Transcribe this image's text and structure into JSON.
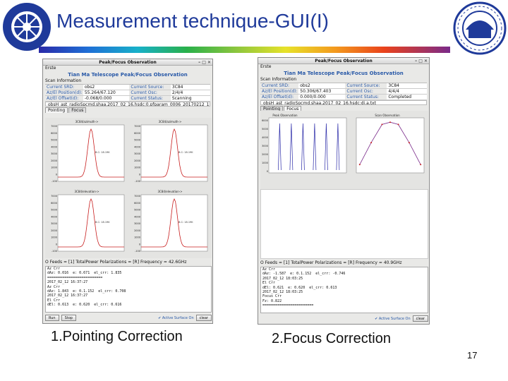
{
  "slide": {
    "title": "Measurement technique-GUI(I)",
    "captions": [
      "1.Pointing Correction",
      "2.Focus Correction"
    ],
    "page_number": "17"
  },
  "colors": {
    "title": "#1f3a9a",
    "accent_blue": "#2a5aa8",
    "plot_red": "#c81e1e",
    "plot_navy": "#2a2aa8",
    "plot_purple": "#7a2a8a"
  },
  "logos": {
    "left": "the-chinese-academy-of-sciences-seal",
    "right": "shanghai-astronomical-observatory-seal"
  },
  "windows": [
    {
      "window_title": "Peak/Focus Observation",
      "menu": "Erste",
      "app_title": "Tian Ma Telescope Peak/Focus Observation",
      "scan_info_label": "Scan Information",
      "info": [
        {
          "label": "Current SRD:",
          "value": "obs2",
          "label2": "Current Source:",
          "value2": "3C84"
        },
        {
          "label": "Az/El Position(d):",
          "value": "55.264/67.120",
          "label2": "Current Osc:",
          "value2": "2/4/4"
        },
        {
          "label": "Az/El Offset(d):",
          "value": "-0.068/0.000",
          "label2": "Current Status:",
          "value2": "Scanning"
        }
      ],
      "file": "obsH_ast_radioSpcmd.shaa.2017_02_16.hsdc:0.pfparam_0006_20170212_153347_obs",
      "tabs": [
        "Pointing",
        "Focus"
      ],
      "plots": [
        {
          "title": "3C84/azimuth->",
          "annot": "B.C: 18.19K"
        },
        {
          "title": "3C84/azimuth->",
          "annot": "B.C: 18.19K"
        },
        {
          "title": "3C84/elevation->",
          "annot": "B.C: 18.19K"
        },
        {
          "title": "3C84/elevation->",
          "annot": "B.C: 18.19K"
        }
      ],
      "y_ticks": [
        "7000",
        "6000",
        "5000",
        "4000",
        "3000",
        "2000",
        "1000",
        "0",
        "-100"
      ],
      "status": "O  Feeds = [1]  TotalPower  Polarizations = [R]  Frequency = 42.6GHz",
      "log": [
        "Az Crr",
        "dAz: 0.016  e: 0.671  el_crr: 1.835",
        "==========================",
        "2017_02_12 16:37:27",
        "Az Crr",
        "dAz: 1.843  e: 0.1.152  el_crr: 0.708",
        "2017_02_12 16:37:27",
        "El Crr",
        "dEl: 0.613  e: 0.620  el_crr: 0.616"
      ],
      "buttons": [
        "Run",
        "Stop"
      ],
      "checkbox": "Active Surface On",
      "action_button": "clear"
    },
    {
      "window_title": "Peak/Focus Observation",
      "menu": "Erste",
      "app_title": "Tian Ma Telescope Peak/Focus Observation",
      "scan_info_label": "Scan Information",
      "info": [
        {
          "label": "Current SRD:",
          "value": "obs2",
          "label2": "Current Source:",
          "value2": "3C84"
        },
        {
          "label": "Az/El Position(d):",
          "value": "50.306/67.403",
          "label2": "Current Osc:",
          "value2": "4/4/4"
        },
        {
          "label": "Az/El Offset(d):",
          "value": "0.000/0.000",
          "label2": "Current Status:",
          "value2": "Completed"
        }
      ],
      "file": "obsH_ast_radioSpcmd.shaa.2017_02_16.hsdc:dj.a.txt",
      "tabs": [
        "Pointing",
        "Focus"
      ],
      "plots": [
        {
          "title": "Peak Observation"
        },
        {
          "title": "Scan Observation"
        }
      ],
      "y_ticks": [
        "6000",
        "5000",
        "4000",
        "3000",
        "2000",
        "1000",
        "0"
      ],
      "status": "O  Feeds = [1]  TotalPower  Polarizations = [R]  Frequency = 40.9GHz",
      "log": [
        "Az Crr",
        "dAz: -1.587  e: 0.1.152  el_crr: -0.746",
        "2017_02_12 18:03:25",
        "El Crr",
        "dEl: 0.621  e: 0.620  el_crr: 0.613",
        "2017_02_12 18:03:25",
        "Focus Crr",
        "Fz: 0.822",
        "========================"
      ],
      "buttons": [],
      "checkbox": "Active Surface On",
      "action_button": "clear"
    }
  ]
}
